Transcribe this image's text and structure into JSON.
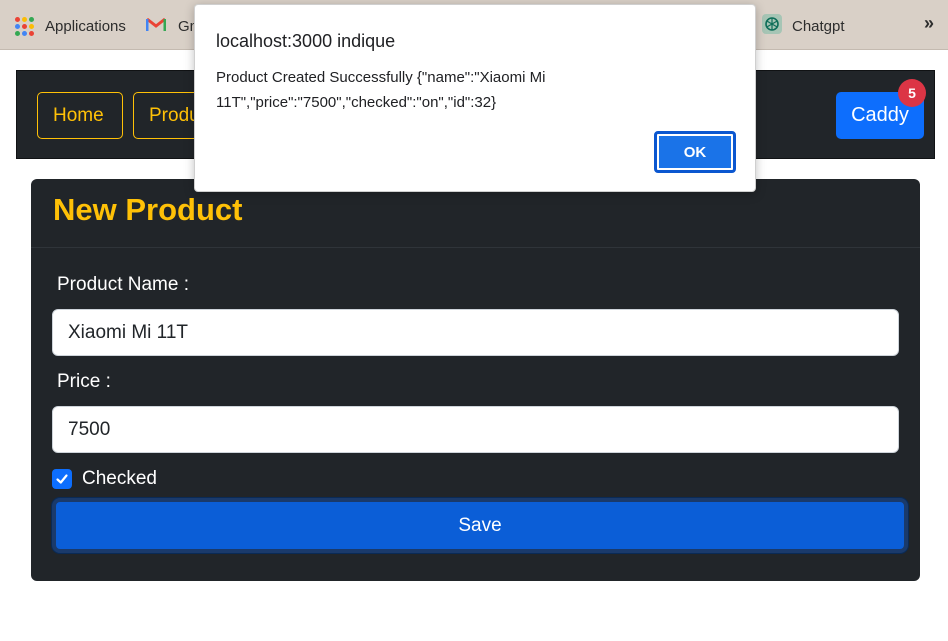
{
  "bookmarks": {
    "apps_label": "Applications",
    "gmail_label": "Gm",
    "chatgpt_label": "Chatgpt",
    "more_label": "»"
  },
  "navbar": {
    "home_label": "Home",
    "products_label": "Produ",
    "cart_label": "Caddy",
    "cart_count": "5"
  },
  "form": {
    "title": "New Product",
    "name_label": "Product Name :",
    "name_value": "Xiaomi Mi 11T",
    "price_label": "Price :",
    "price_value": "7500",
    "checked_label": "Checked",
    "checked": true,
    "save_label": "Save"
  },
  "dialog": {
    "title": "localhost:3000 indique",
    "message": "Product Created Successfully {\"name\":\"Xiaomi Mi 11T\",\"price\":\"7500\",\"checked\":\"on\",\"id\":32}",
    "ok_label": "OK"
  },
  "colors": {
    "accent": "#ffc107",
    "primary": "#0d6efd",
    "badge": "#dc3545",
    "dark_bg": "#212529"
  }
}
